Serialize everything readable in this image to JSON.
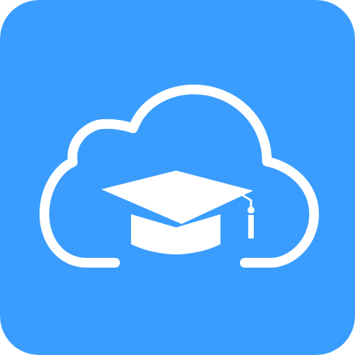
{
  "icon": {
    "name": "education-cloud-app-icon",
    "glyphs": [
      "cloud-icon",
      "graduation-cap-icon"
    ]
  },
  "colors": {
    "background": "#3A9DFE",
    "foreground": "#FFFFFF"
  }
}
